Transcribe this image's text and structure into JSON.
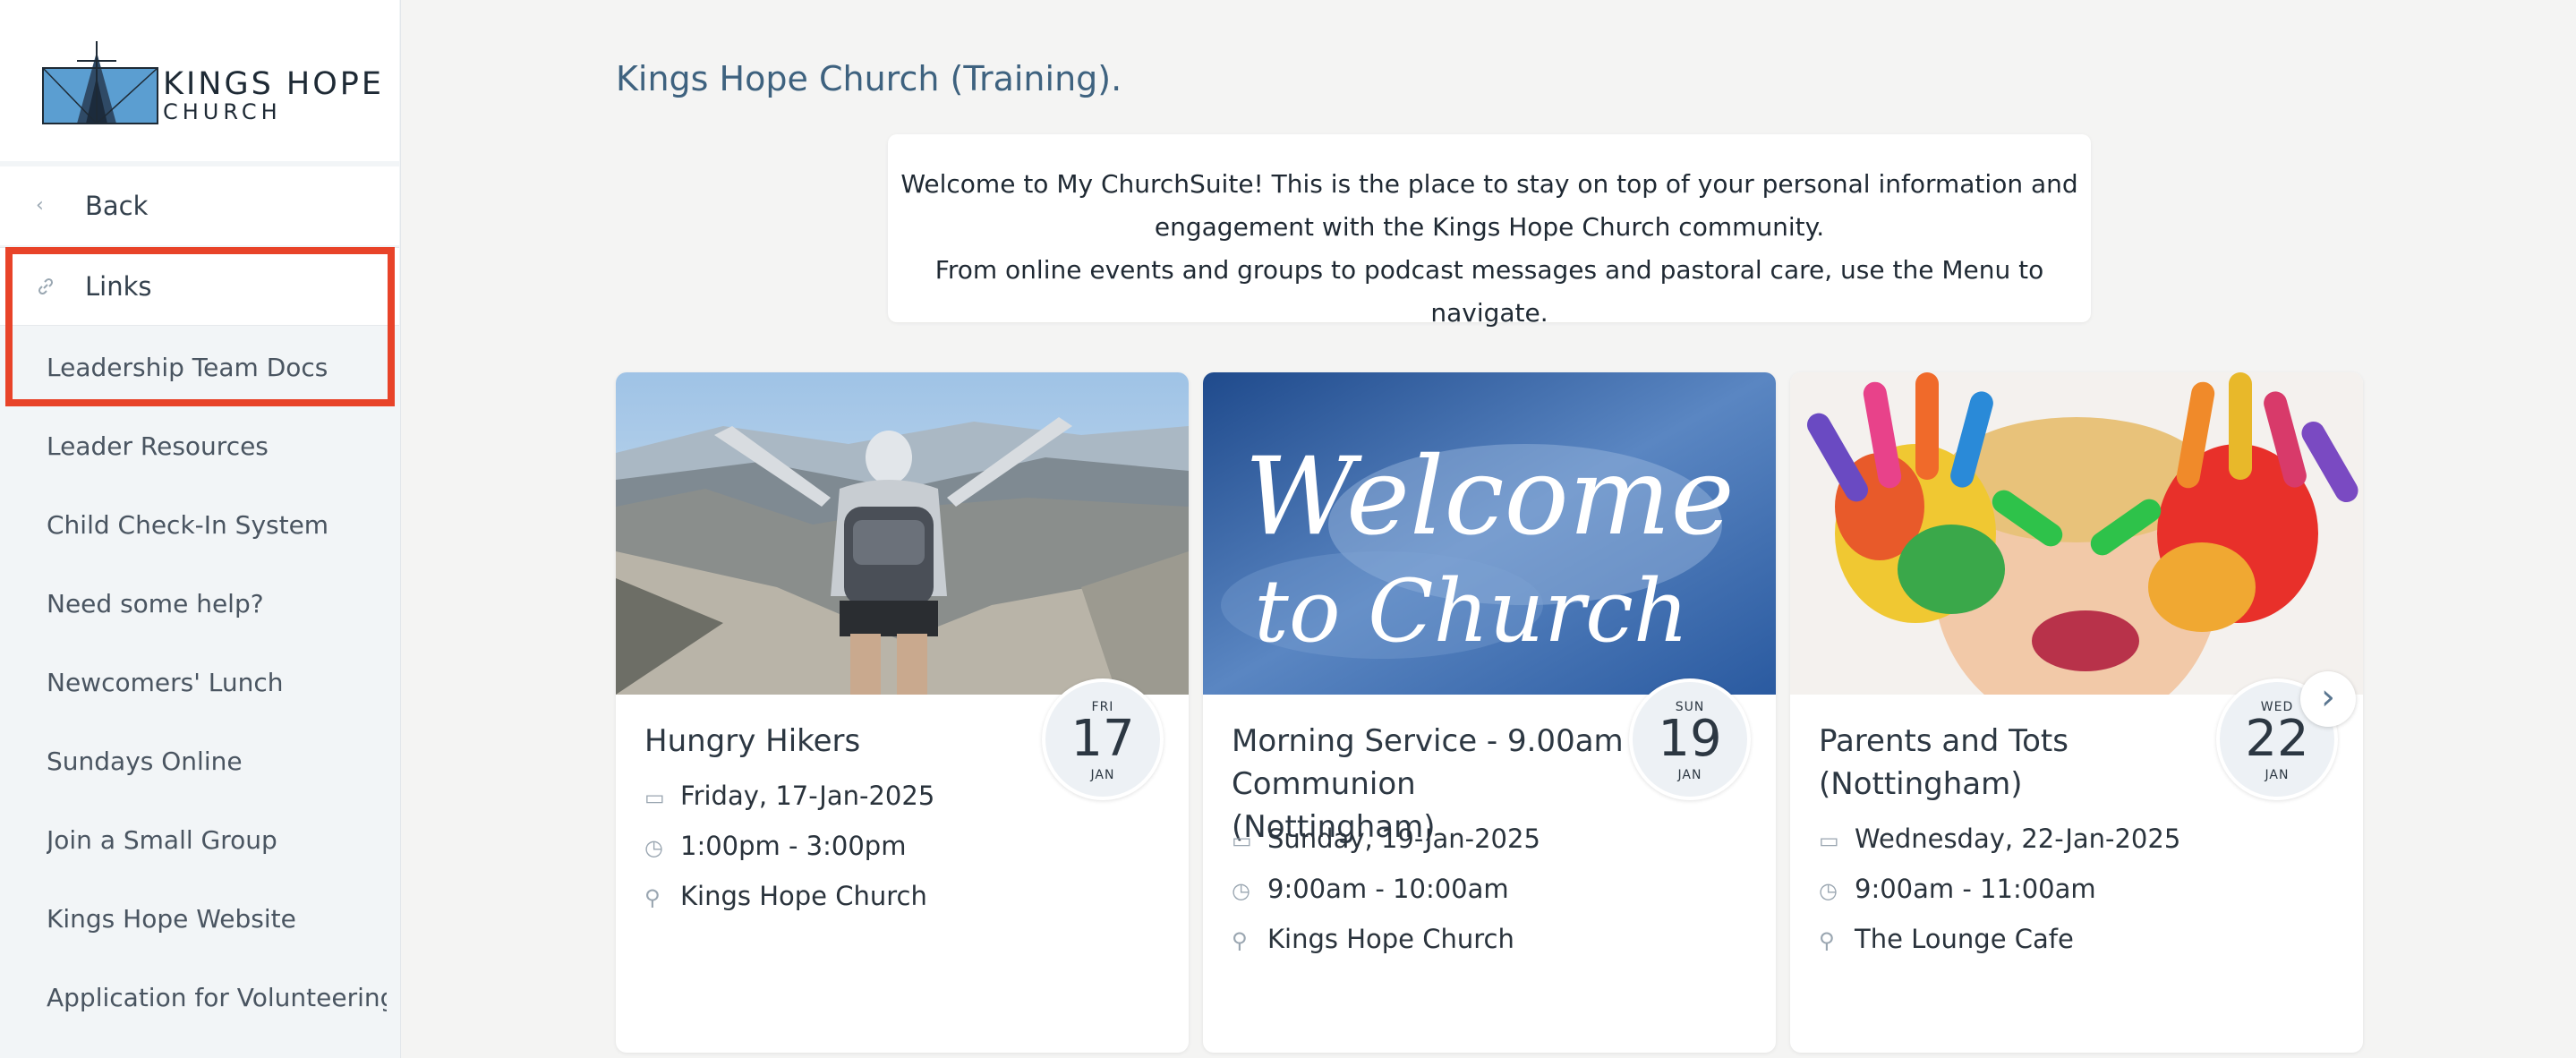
{
  "logo": {
    "line1": "KINGS HOPE",
    "line2": "CHURCH"
  },
  "nav": {
    "back_label": "Back",
    "links_label": "Links",
    "back_icon": "chevron-left-icon",
    "links_icon": "link-icon",
    "items": [
      {
        "label": "Leadership Team Docs"
      },
      {
        "label": "Leader Resources"
      },
      {
        "label": "Child Check-In System"
      },
      {
        "label": "Need some help?"
      },
      {
        "label": "Newcomers' Lunch"
      },
      {
        "label": "Sundays Online"
      },
      {
        "label": "Join a Small Group"
      },
      {
        "label": "Kings Hope Website"
      },
      {
        "label": "Application for Volunteering"
      }
    ]
  },
  "main": {
    "title": "Kings Hope Church (Training).",
    "welcome": {
      "line1": "Welcome to My ChurchSuite! This is the place to stay on top of your personal information and",
      "line2": "engagement with the Kings Hope Church community.",
      "line3": "From online events and groups to podcast messages and pastoral care, use the Menu to navigate."
    },
    "events": [
      {
        "title": "Hungry Hikers",
        "date": "Friday, 17-Jan-2025",
        "time": "1:00pm - 3:00pm",
        "location": "Kings Hope Church",
        "badge": {
          "dow": "FRI",
          "day": "17",
          "month": "JAN"
        }
      },
      {
        "title": "Morning Service - 9.00am Communion (Nottingham)",
        "date": "Sunday, 19-Jan-2025",
        "time": "9:00am - 10:00am",
        "location": "Kings Hope Church",
        "badge": {
          "dow": "SUN",
          "day": "19",
          "month": "JAN"
        },
        "image_text": {
          "line1": "Welcome",
          "line2": "to Church"
        }
      },
      {
        "title": "Parents and Tots (Nottingham)",
        "date": "Wednesday, 22-Jan-2025",
        "time": "9:00am - 11:00am",
        "location": "The Lounge Cafe",
        "badge": {
          "dow": "WED",
          "day": "22",
          "month": "JAN"
        }
      }
    ]
  },
  "colors": {
    "highlight": "#e84329",
    "title": "#3e627f",
    "sidebar_bg": "#f2f5f7"
  }
}
